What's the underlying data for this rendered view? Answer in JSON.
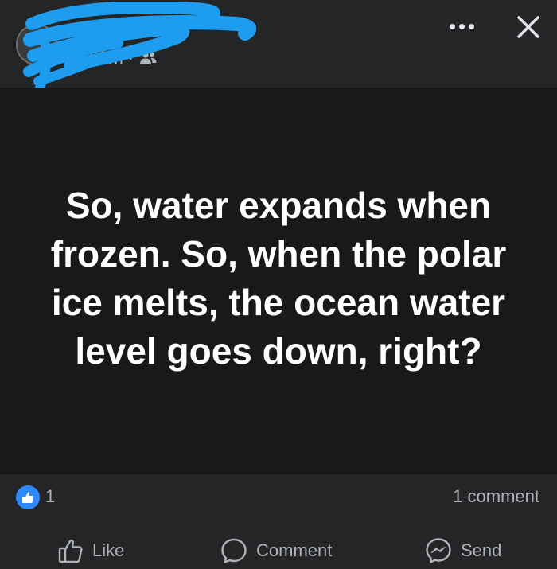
{
  "header": {
    "timestamp": "23m",
    "separator": "·",
    "audience_icon": "friends-icon",
    "more_icon": "more-horizontal-icon",
    "close_icon": "close-icon"
  },
  "post": {
    "text": "So, water expands when frozen. So, when the polar ice melts, the ocean water level goes down, right?",
    "background_color": "#18191a",
    "text_color": "#ffffff"
  },
  "stats": {
    "like_count": "1",
    "comment_count": "1 comment",
    "reaction_icon": "like-reaction-icon",
    "reaction_color": "#2e89ff"
  },
  "actions": {
    "like_label": "Like",
    "comment_label": "Comment",
    "send_label": "Send"
  },
  "overlay": {
    "redaction_color": "#1e9cf0"
  }
}
